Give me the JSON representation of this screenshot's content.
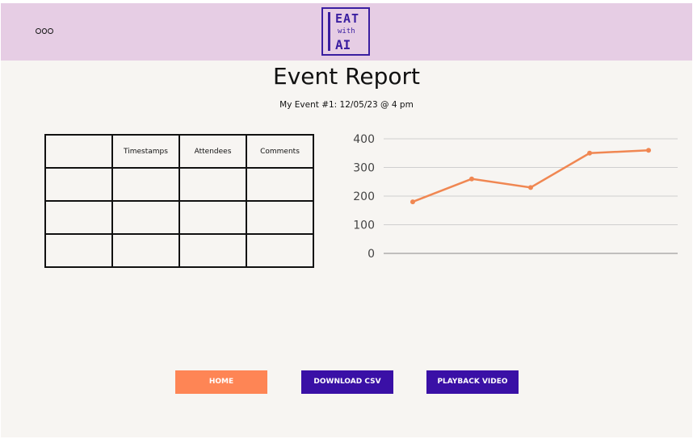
{
  "header": {
    "logo_line1": "EAT",
    "logo_line2": "with",
    "logo_line3": "AI"
  },
  "page": {
    "title": "Event Report",
    "subtitle": "My Event #1: 12/05/23 @ 4 pm"
  },
  "table": {
    "headers": [
      "",
      "Timestamps",
      "Attendees",
      "Comments"
    ],
    "rows": [
      [
        "",
        "",
        "",
        ""
      ],
      [
        "",
        "",
        "",
        ""
      ],
      [
        "",
        "",
        "",
        ""
      ]
    ]
  },
  "chart_data": {
    "type": "line",
    "x": [
      1,
      2,
      3,
      4,
      5
    ],
    "values": [
      180,
      260,
      230,
      350,
      360
    ],
    "yticks": [
      0,
      100,
      200,
      300,
      400
    ],
    "ylim": [
      0,
      400
    ],
    "grid": true,
    "color": "#f08752"
  },
  "buttons": {
    "home": "HOME",
    "download_csv": "DOWNLOAD CSV",
    "playback_video": "PLAYBACK VIDEO"
  },
  "colors": {
    "header_bg": "#e6cde4",
    "page_bg": "#f7f5f2",
    "accent_orange": "#fe8555",
    "accent_purple": "#3a10a6"
  }
}
